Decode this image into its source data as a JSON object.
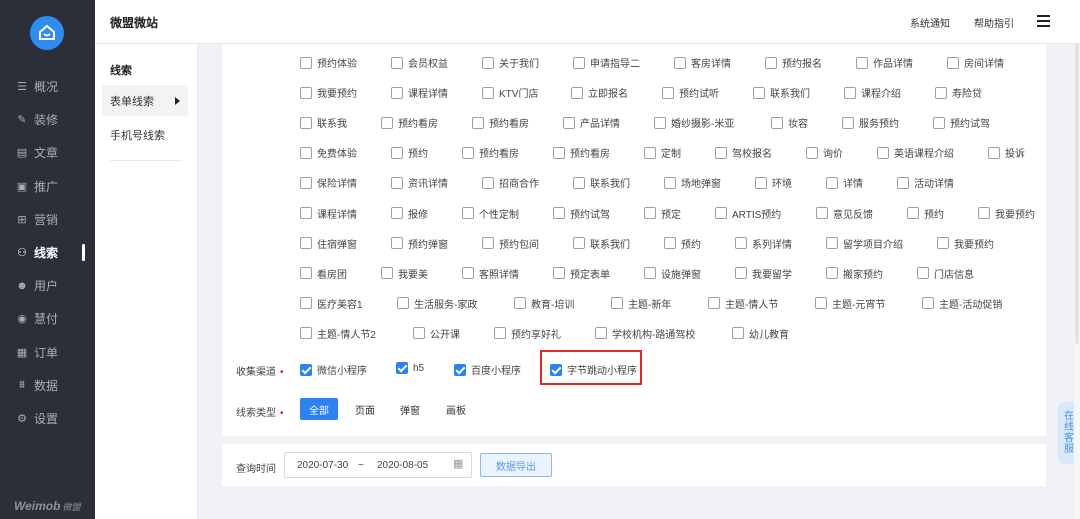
{
  "app": {
    "title": "微盟微站"
  },
  "topbar": {
    "notify": "系统通知",
    "help": "帮助指引"
  },
  "nav": {
    "items": [
      {
        "icon": "bars-icon",
        "glyph": "☰",
        "label": "概况"
      },
      {
        "icon": "brush-icon",
        "glyph": "✎",
        "label": "装修"
      },
      {
        "icon": "document-icon",
        "glyph": "▤",
        "label": "文章"
      },
      {
        "icon": "promo-icon",
        "glyph": "▣",
        "label": "推广"
      },
      {
        "icon": "gift-icon",
        "glyph": "⊞",
        "label": "营销"
      },
      {
        "icon": "user-lead-icon",
        "glyph": "⚇",
        "label": "线索"
      },
      {
        "icon": "person-icon",
        "glyph": "☻",
        "label": "用户"
      },
      {
        "icon": "coin-icon",
        "glyph": "◉",
        "label": "慧付"
      },
      {
        "icon": "order-icon",
        "glyph": "▦",
        "label": "订单"
      },
      {
        "icon": "chart-icon",
        "glyph": "⩩",
        "label": "数据"
      },
      {
        "icon": "gear-icon",
        "glyph": "⚙",
        "label": "设置"
      }
    ],
    "active_index": 5,
    "brand": "Weimob",
    "brand_sub": "微盟"
  },
  "submenu": {
    "heading": "线索",
    "items": [
      "表单线索",
      "手机号线索"
    ]
  },
  "form_tags": [
    [
      "预约体验",
      "会员权益",
      "关于我们",
      "申请指导二",
      "客房详情",
      "预约报名",
      "作品详情",
      "房间详情"
    ],
    [
      "我要预约",
      "课程详情",
      "KTV门店",
      "立即报名",
      "预约试听",
      "联系我们",
      "课程介绍",
      "寿险贷"
    ],
    [
      "联系我",
      "预约看房",
      "预约看房",
      "产品详情",
      "婚纱摄影-米亚",
      "妆容",
      "服务预约",
      "预约试驾"
    ],
    [
      "免费体验",
      "预约",
      "预约看房",
      "预约看房",
      "定制",
      "驾校报名",
      "询价",
      "英语课程介绍",
      "投诉"
    ],
    [
      "保险详情",
      "资讯详情",
      "招商合作",
      "联系我们",
      "场地弹窗",
      "环境",
      "详情",
      "活动详情"
    ],
    [
      "课程详情",
      "报修",
      "个性定制",
      "预约试驾",
      "预定",
      "ARTIS预约",
      "意见反馈",
      "预约",
      "我要预约"
    ],
    [
      "住宿弹窗",
      "预约弹窗",
      "预约包间",
      "联系我们",
      "预约",
      "系列详情",
      "留学项目介绍",
      "我要预约"
    ],
    [
      "看房团",
      "我要美",
      "客照详情",
      "预定表单",
      "设施弹窗",
      "我要留学",
      "搬家预约",
      "门店信息"
    ],
    [
      "医疗美容1",
      "生活服务-家政",
      "教育-培训",
      "主题-新年",
      "主题-情人节",
      "主题-元宵节",
      "主题-活动促销"
    ],
    [
      "主题-情人节2",
      "公开课",
      "预约享好礼",
      "学校机构-路通驾校",
      "幼儿教育"
    ]
  ],
  "channels": {
    "label": "收集渠道",
    "options": [
      {
        "label": "微信小程序",
        "checked": true
      },
      {
        "label": "h5",
        "checked": true
      },
      {
        "label": "百度小程序",
        "checked": true
      },
      {
        "label": "字节跳动小程序",
        "checked": true
      }
    ]
  },
  "lead_type": {
    "label": "线索类型",
    "options": [
      "全部",
      "页面",
      "弹窗",
      "画板"
    ],
    "selected": "全部"
  },
  "query": {
    "label": "查询时间",
    "start": "2020-07-30",
    "separator": "~",
    "end": "2020-08-05",
    "export_label": "数据导出"
  },
  "online_service": "在线客服",
  "colors": {
    "accent": "#2b82f0",
    "nav_bg": "#2b2f3a",
    "highlight": "#e02828"
  }
}
